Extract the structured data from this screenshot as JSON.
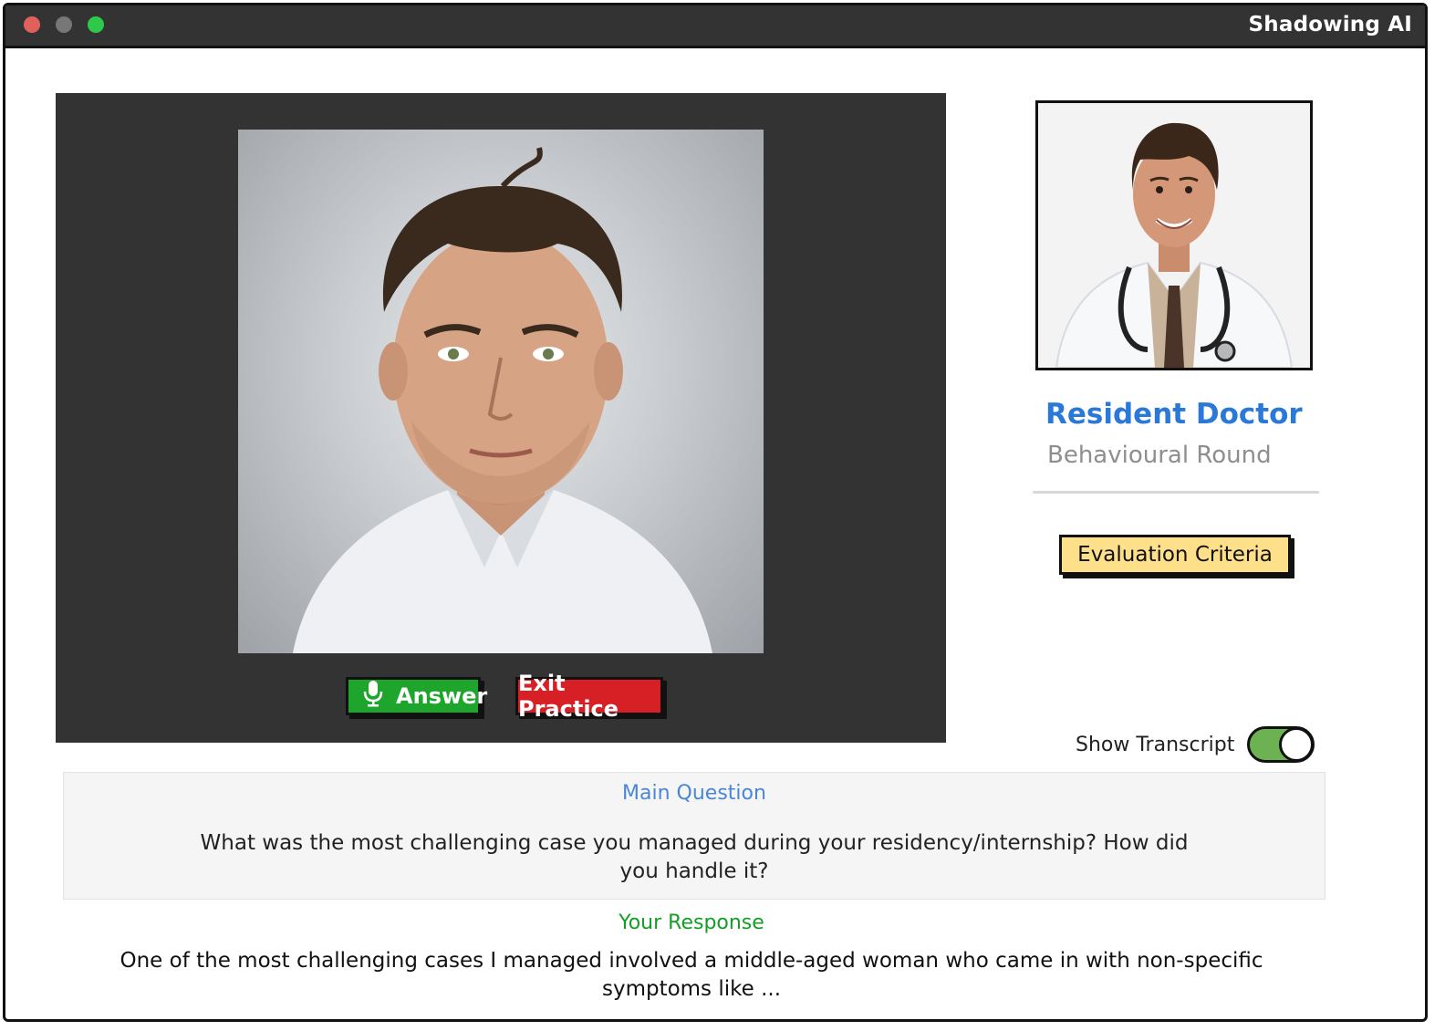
{
  "app": {
    "title": "Shadowing AI"
  },
  "video": {
    "answer_label": "Answer",
    "exit_label": "Exit Practice"
  },
  "profile": {
    "role": "Resident Doctor",
    "round": "Behavioural Round",
    "evaluation_label": "Evaluation Criteria"
  },
  "transcript": {
    "toggle_label": "Show Transcript",
    "enabled": true
  },
  "question": {
    "label": "Main Question",
    "text": "What was the most challenging case you managed during your residency/internship? How did you handle it?"
  },
  "response": {
    "label": "Your Response",
    "text": "One of the most challenging cases I managed involved a middle-aged woman who came in with non-specific symptoms like  ..."
  },
  "colors": {
    "answer": "#1da52c",
    "exit": "#d62026",
    "role": "#2a78d8",
    "evaluation": "#ffe08a",
    "toggle_on": "#6cb253"
  },
  "icons": [
    "microphone-icon"
  ]
}
